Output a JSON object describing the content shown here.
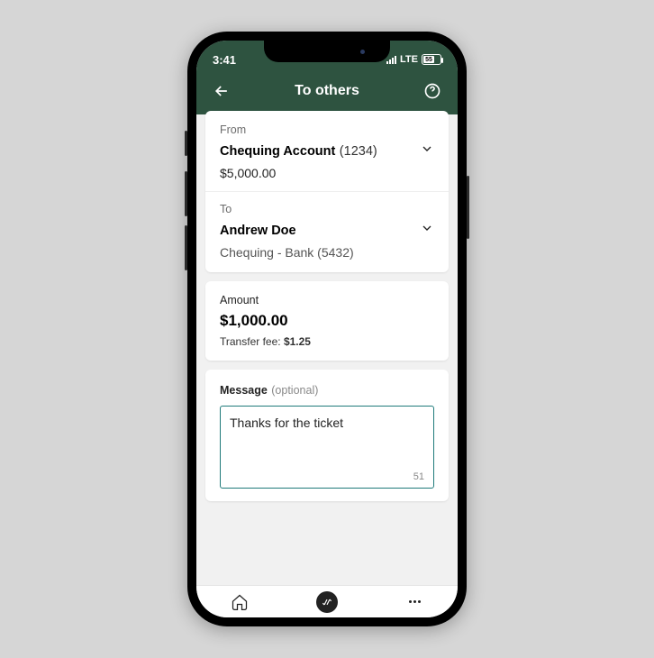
{
  "status": {
    "time": "3:41",
    "network": "LTE",
    "battery": "55"
  },
  "header": {
    "title": "To others"
  },
  "from": {
    "label": "From",
    "account_name": "Chequing Account",
    "account_number": "(1234)",
    "balance": "$5,000.00"
  },
  "to": {
    "label": "To",
    "name": "Andrew Doe",
    "detail": "Chequing - Bank (5432)"
  },
  "amount": {
    "label": "Amount",
    "value": "$1,000.00",
    "fee_label": "Transfer fee:",
    "fee_value": "$1.25"
  },
  "message": {
    "label": "Message",
    "optional": "(optional)",
    "value": "Thanks for the ticket",
    "count": "51"
  }
}
